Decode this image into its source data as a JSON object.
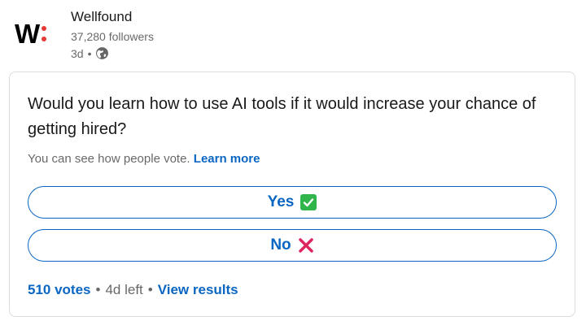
{
  "post": {
    "company_name": "Wellfound",
    "logo_icon": "wellfound-logo-icon",
    "followers": "37,280 followers",
    "age": "3d",
    "separator": "•",
    "visibility_icon": "globe-icon"
  },
  "poll": {
    "question": "Would you learn how to use AI tools if it would increase your chance of getting hired?",
    "visibility_text": "You can see how people vote.",
    "learn_more": "Learn more",
    "options": [
      {
        "label": "Yes",
        "icon": "check-mark-icon"
      },
      {
        "label": "No",
        "icon": "cross-mark-icon"
      }
    ],
    "votes": "510 votes",
    "separator": "•",
    "time_left": "4d left",
    "view_results": "View results"
  },
  "colors": {
    "link": "#0a66c2",
    "logo_dot": "#e53935",
    "check_bg": "#2fb54a",
    "cross": "#e0245e"
  }
}
